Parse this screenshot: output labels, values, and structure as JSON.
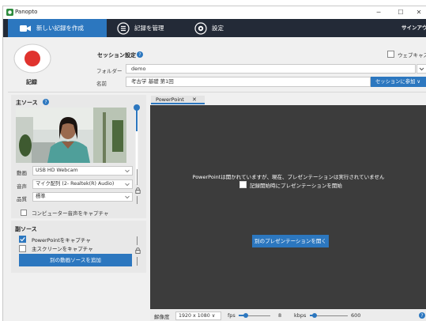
{
  "window": {
    "title": "Panopto",
    "minimize_glyph": "─",
    "maximize_glyph": "☐",
    "close_glyph": "✕"
  },
  "nav": {
    "tabs": [
      {
        "label": "新しい記録を作成",
        "icon": "video-camera-icon",
        "active": true
      },
      {
        "label": "記録を管理",
        "icon": "list-icon",
        "active": false
      },
      {
        "label": "設定",
        "icon": "gear-icon",
        "active": false
      }
    ],
    "signout_label": "サインアウト"
  },
  "record": {
    "label": "記録"
  },
  "session": {
    "settings_label": "セッション設定",
    "webcast_label": "ウェブキャスト",
    "folder_label": "フォルダー",
    "folder_value": "demo",
    "name_label": "名前",
    "name_value": "考古学 基礎 第1回",
    "join_button": "セッションに参加 ∨"
  },
  "main_source": {
    "title": "主ソース",
    "video_label": "動画",
    "video_value": "USB HD Webcam",
    "audio_label": "音声",
    "audio_value": "マイク配列 (2- Realtek(R) Audio)",
    "quality_label": "品質",
    "quality_value": "標準",
    "computer_audio_label": "コンピューター音声をキャプチャ",
    "computer_audio_checked": false
  },
  "secondary_source": {
    "title": "副ソース",
    "ppt_capture_label": "PowerPointをキャプチャ",
    "ppt_capture_checked": true,
    "screen_capture_label": "主スクリーンをキャプチャ",
    "screen_capture_checked": false,
    "add_video_button": "別の動画ソースを追加"
  },
  "ppt_panel": {
    "tab_label": "PowerPoint",
    "tab_close": "✕",
    "message": "PowerPointは開かれていますが、現在、プレゼンテーションは実行されていません",
    "autostart_label": "記録開始時にプレゼンテーションを開始",
    "autostart_checked": false,
    "open_button": "別のプレゼンテーションを開く"
  },
  "bottom_bar": {
    "resolution_label": "解像度",
    "resolution_value": "1920 x 1080 ∨",
    "fps_label": "fps",
    "fps_value": "8",
    "fps_level": 0.22,
    "kbps_label": "kbps",
    "kbps_value": "600",
    "kbps_level": 0.12
  },
  "colors": {
    "accent": "#2c77bf",
    "navbar": "#232a37",
    "preview_bg": "#3c3c3c",
    "record_red": "#e0332e"
  }
}
